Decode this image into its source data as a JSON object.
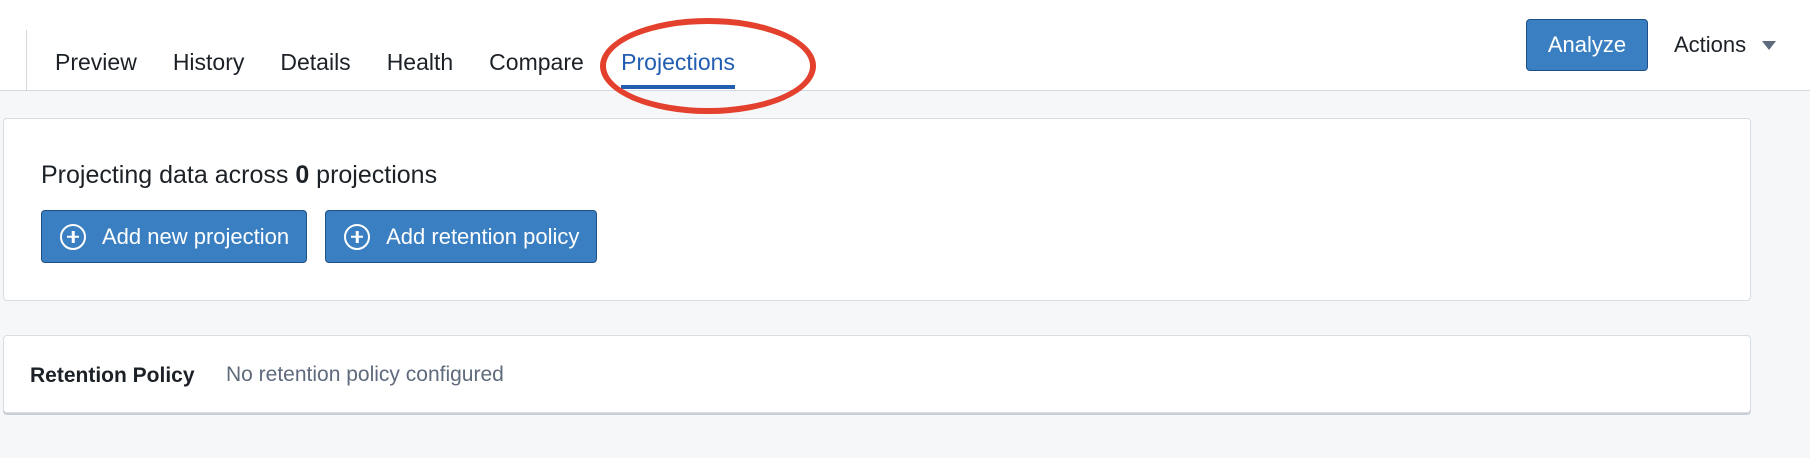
{
  "tabs": [
    {
      "label": "Preview"
    },
    {
      "label": "History"
    },
    {
      "label": "Details"
    },
    {
      "label": "Health"
    },
    {
      "label": "Compare"
    },
    {
      "label": "Projections",
      "active": true
    }
  ],
  "header": {
    "analyze_label": "Analyze",
    "actions_label": "Actions"
  },
  "projections": {
    "title_prefix": "Projecting data across",
    "count": "0",
    "title_suffix": "projections",
    "add_projection_label": "Add new projection",
    "add_retention_label": "Add retention policy"
  },
  "retention": {
    "label": "Retention Policy",
    "value": "No retention policy configured"
  },
  "colors": {
    "primary_button": "#3a7fc1",
    "active_tab": "#215db0",
    "annotation": "#e3402d"
  },
  "icons": [
    "plus-circle-icon",
    "caret-down-icon"
  ]
}
